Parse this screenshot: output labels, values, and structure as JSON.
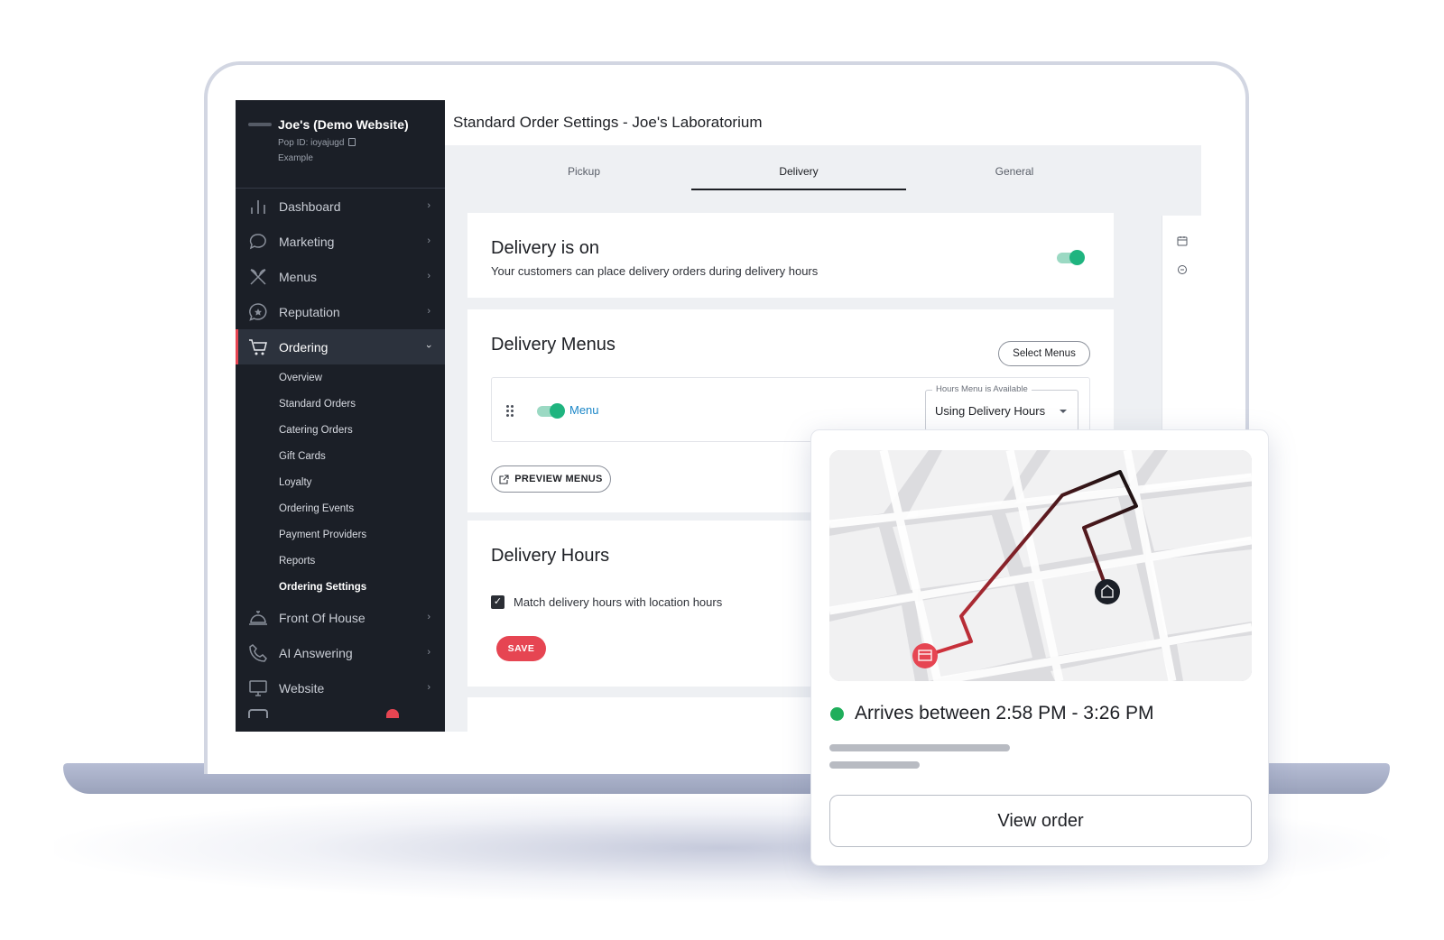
{
  "brand": {
    "title": "Joe's (Demo Website)",
    "pop_id": "Pop ID: ioyajugd",
    "subtitle": "Example"
  },
  "sidebar": {
    "items": [
      {
        "label": "Dashboard",
        "icon": "bar-chart-icon"
      },
      {
        "label": "Marketing",
        "icon": "chat-bubble-icon"
      },
      {
        "label": "Menus",
        "icon": "utensils-icon"
      },
      {
        "label": "Reputation",
        "icon": "star-bubble-icon"
      },
      {
        "label": "Ordering",
        "icon": "cart-icon",
        "active": true
      },
      {
        "label": "Front Of House",
        "icon": "service-bell-icon"
      },
      {
        "label": "AI Answering",
        "icon": "phone-icon"
      },
      {
        "label": "Website",
        "icon": "monitor-icon"
      }
    ],
    "ordering_sub": [
      "Overview",
      "Standard Orders",
      "Catering Orders",
      "Gift Cards",
      "Loyalty",
      "Ordering Events",
      "Payment Providers",
      "Reports",
      "Ordering Settings"
    ],
    "current_sub": "Ordering Settings"
  },
  "page": {
    "title": "Standard Order Settings - Joe's Laboratorium"
  },
  "tabs": [
    {
      "label": "Pickup"
    },
    {
      "label": "Delivery",
      "active": true
    },
    {
      "label": "General"
    }
  ],
  "delivery_status": {
    "title": "Delivery is on",
    "description": "Your customers can place delivery orders during delivery hours",
    "enabled": true
  },
  "delivery_menus": {
    "title": "Delivery Menus",
    "select_button": "Select Menus",
    "menu_name": "Menu",
    "menu_enabled": true,
    "availability_label": "Hours Menu is Available",
    "availability_value": "Using Delivery Hours",
    "preview_button": "PREVIEW MENUS"
  },
  "delivery_hours": {
    "title": "Delivery Hours",
    "checkbox_label": "Match delivery hours with location hours",
    "checked": true,
    "save_button": "SAVE"
  },
  "order_card": {
    "eta": "Arrives between 2:58 PM - 3:26 PM",
    "view_button": "View order"
  },
  "colors": {
    "sidebar_bg": "#1b1f27",
    "accent_red": "#e64552",
    "toggle_green": "#1fb47f",
    "link_blue": "#1a86c7",
    "status_green": "#1fae5b"
  }
}
